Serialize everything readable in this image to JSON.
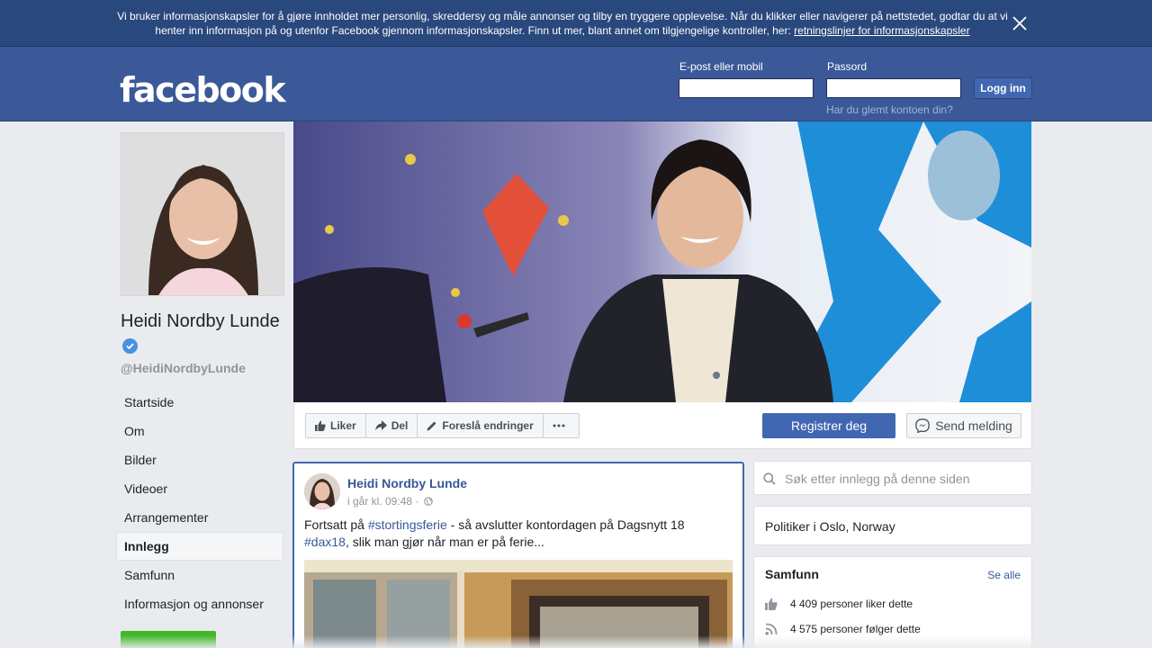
{
  "cookie_banner": {
    "text": "Vi bruker informasjonskapsler for å gjøre innholdet mer personlig, skreddersy og måle annonser og tilby en tryggere opplevelse. Når du klikker eller navigerer på nettstedet, godtar du at vi henter inn informasjon på og utenfor Facebook gjennom informasjonskapsler. Finn ut mer, blant annet om tilgjengelige kontroller, her: ",
    "link": "retningslinjer for informasjonskapsler"
  },
  "header": {
    "logo": "facebook",
    "email_label": "E-post eller mobil",
    "password_label": "Passord",
    "login_button": "Logg inn",
    "forgot_link": "Har du glemt kontoen din?"
  },
  "profile": {
    "name": "Heidi Nordby Lunde",
    "handle": "@HeidiNordbyLunde"
  },
  "nav": {
    "items": [
      "Startside",
      "Om",
      "Bilder",
      "Videoer",
      "Arrangementer",
      "Innlegg",
      "Samfunn",
      "Informasjon og annonser"
    ],
    "active": "Innlegg"
  },
  "actions": {
    "like": "Liker",
    "share": "Del",
    "suggest": "Foreslå endringer",
    "register": "Registrer deg",
    "message": "Send melding"
  },
  "post": {
    "author": "Heidi Nordby Lunde",
    "time": "i går kl. 09:48 ·",
    "text_prefix": "Fortsatt på ",
    "tag1": "#stortingsferie",
    "text_middle": " - så avslutter kontordagen på Dagsnytt 18",
    "tag2": "#dax18",
    "text_suffix": ", slik man gjør når man er på ferie..."
  },
  "sidebar": {
    "search_placeholder": "Søk etter innlegg på denne siden",
    "category": "Politiker i Oslo, Norway",
    "community_title": "Samfunn",
    "see_all": "Se alle",
    "likes": "4 409 personer liker dette",
    "follows": "4 575 personer følger dette"
  },
  "colors": {
    "brand_blue": "#3b5998",
    "banner_blue": "#29487d",
    "button_blue": "#4267b2",
    "link_blue": "#365899",
    "green": "#42b72a",
    "background": "#e9ebee"
  }
}
